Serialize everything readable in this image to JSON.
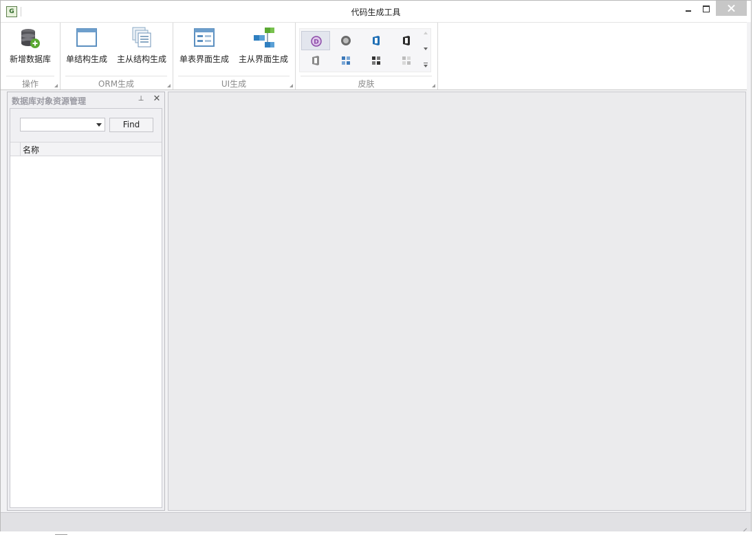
{
  "window": {
    "title": "代码生成工具",
    "app_icon_text": "G"
  },
  "ribbon": {
    "groups": [
      {
        "caption": "操作",
        "buttons": [
          {
            "label": "新增数据库",
            "icon": "database-add-icon"
          }
        ]
      },
      {
        "caption": "ORM生成",
        "buttons": [
          {
            "label": "单结构生成",
            "icon": "window-form-icon"
          },
          {
            "label": "主从结构生成",
            "icon": "stacked-forms-icon"
          }
        ]
      },
      {
        "caption": "UI生成",
        "buttons": [
          {
            "label": "单表界面生成",
            "icon": "form-layout-icon"
          },
          {
            "label": "主从界面生成",
            "icon": "hierarchy-blocks-icon"
          }
        ]
      },
      {
        "caption": "皮肤",
        "gallery": [
          "skin-purple-d-icon",
          "skin-gray-d-icon",
          "skin-office-blue-icon",
          "skin-office-black-icon",
          "skin-office-white-icon",
          "skin-blue-tiles-icon",
          "skin-dark-tiles-icon",
          "skin-light-tiles-icon"
        ]
      }
    ]
  },
  "dock": {
    "title": "数据库对象资源管理",
    "combo_value": "",
    "find_label": "Find",
    "grid": {
      "columns": [
        "名称"
      ],
      "rows": []
    }
  },
  "colors": {
    "accent_blue": "#2f7fc0",
    "skin_purple": "#8c4aa8",
    "green": "#5aa832"
  }
}
